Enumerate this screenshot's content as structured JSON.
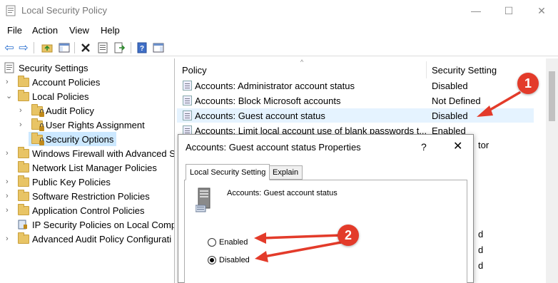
{
  "window": {
    "title": "Local Security Policy",
    "minimize": "—",
    "maximize": "☐",
    "close": "✕"
  },
  "menu": [
    "File",
    "Action",
    "View",
    "Help"
  ],
  "toolbar": {
    "back": "⇦",
    "forward": "⇨"
  },
  "tree": {
    "root": "Security Settings",
    "items": [
      {
        "label": "Account Policies"
      },
      {
        "label": "Local Policies"
      },
      {
        "label": "Audit Policy"
      },
      {
        "label": "User Rights Assignment"
      },
      {
        "label": "Security Options"
      },
      {
        "label": "Windows Firewall with Advanced S"
      },
      {
        "label": "Network List Manager Policies"
      },
      {
        "label": "Public Key Policies"
      },
      {
        "label": "Software Restriction Policies"
      },
      {
        "label": "Application Control Policies"
      },
      {
        "label": "IP Security Policies on Local Comp"
      },
      {
        "label": "Advanced Audit Policy Configurati"
      }
    ]
  },
  "list": {
    "col_policy": "Policy",
    "col_setting": "Security Setting",
    "sort_arrow": "^",
    "rows": [
      {
        "policy": "Accounts: Administrator account status",
        "setting": "Disabled"
      },
      {
        "policy": "Accounts: Block Microsoft accounts",
        "setting": "Not Defined"
      },
      {
        "policy": "Accounts: Guest account status",
        "setting": "Disabled"
      },
      {
        "policy": "Accounts: Limit local account use of blank passwords t...",
        "setting": "Enabled"
      }
    ],
    "partial_right": [
      "tor",
      "d",
      "d",
      "d"
    ]
  },
  "dialog": {
    "title": "Accounts: Guest account status Properties",
    "help": "?",
    "close": "✕",
    "tabs": [
      "Local Security Setting",
      "Explain"
    ],
    "policy_name": "Accounts: Guest account status",
    "options": [
      {
        "label": "Enabled",
        "checked": false
      },
      {
        "label": "Disabled",
        "checked": true
      }
    ]
  },
  "annotations": {
    "callout_1": "1",
    "callout_2": "2",
    "color": "#e33b2a"
  }
}
